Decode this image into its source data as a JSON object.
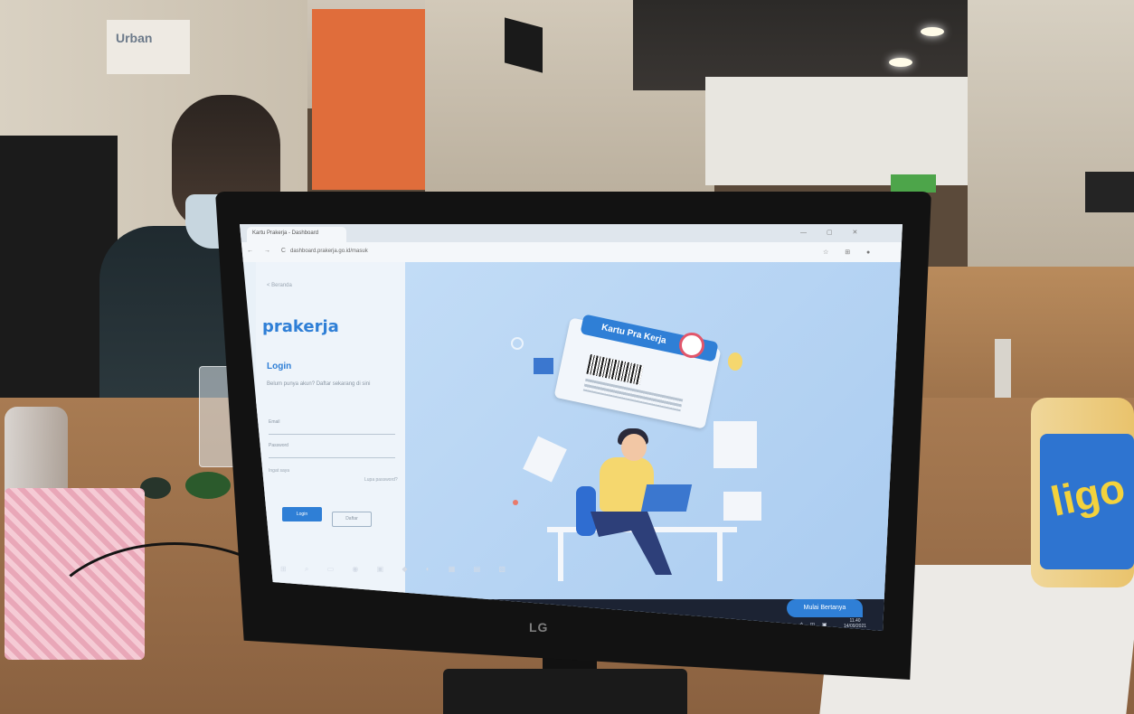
{
  "background": {
    "sign_text": "Urban",
    "monitor_brand": "LG",
    "can_text": "ligo"
  },
  "browser": {
    "tab_title": "Kartu Prakerja - Dashboard",
    "url": "dashboard.prakerja.go.id/masuk",
    "nav_glyphs": "← → C",
    "window_controls": "— ▢ ✕",
    "toolbar_glyphs": "☆ ⊞ ●"
  },
  "login_panel": {
    "back_link": "< Beranda",
    "logo_text": "prakerja",
    "title": "Login",
    "description": "Belum punya akun? Daftar sekarang di sini",
    "email_label": "Email",
    "password_label": "Password",
    "remember_label": "Ingat saya",
    "forgot_label": "Lupa password?",
    "login_button": "Login",
    "register_button": "Daftar"
  },
  "hero": {
    "card_title": "Kartu Pra Kerja",
    "chat_button": "Mulai Bertanya"
  },
  "taskbar": {
    "icons": "⊞ ⌕ ▭ ◉ ▣ ◆ ◐ ▦ ▤ ▧",
    "sys_icons": "^ ◫ ▣",
    "time": "11.40",
    "date": "14/09/2021"
  },
  "colors": {
    "accent": "#2f7fd6",
    "hero_bg": "#b7d4f3",
    "taskbar": "#1c2333"
  }
}
